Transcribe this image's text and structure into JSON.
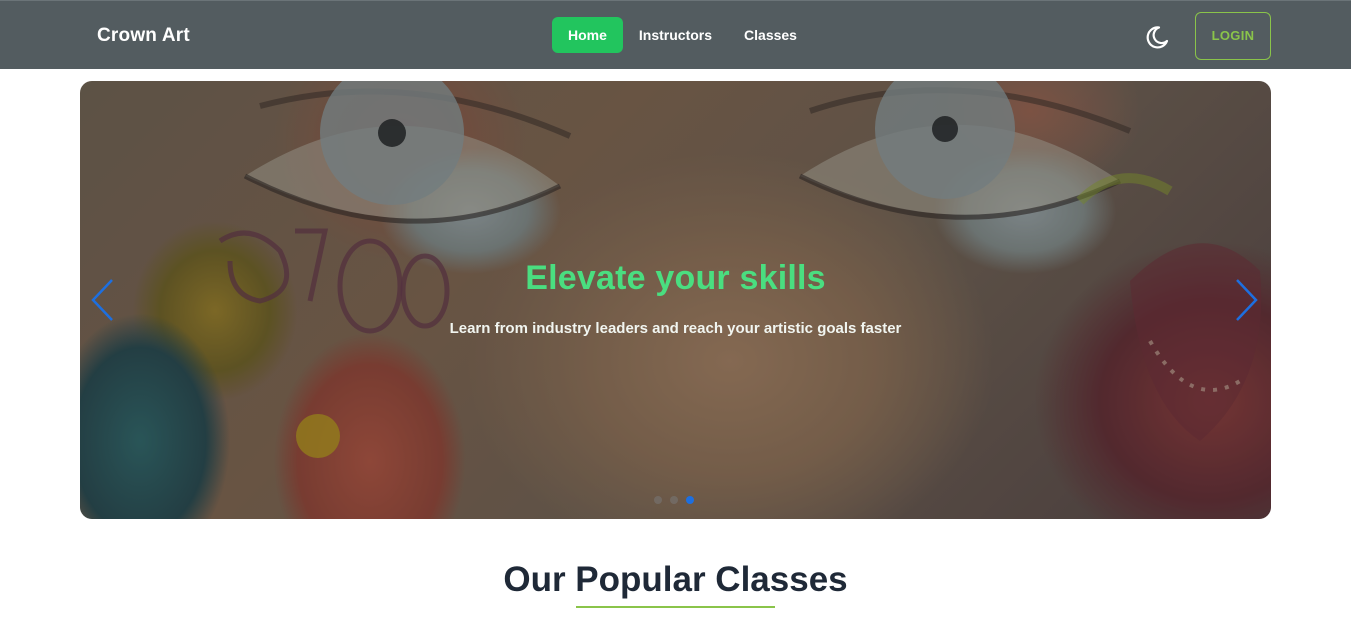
{
  "navbar": {
    "brand": "Crown Art",
    "links": [
      {
        "label": "Home",
        "active": true
      },
      {
        "label": "Instructors",
        "active": false
      },
      {
        "label": "Classes",
        "active": false
      }
    ],
    "theme_icon": "moon-icon",
    "login_label": "LOGIN"
  },
  "hero": {
    "title": "Elevate your skills",
    "subtitle": "Learn from industry leaders and reach your artistic goals faster",
    "prev_icon": "chevron-left-icon",
    "next_icon": "chevron-right-icon",
    "slide_count": 3,
    "active_slide": 3
  },
  "section": {
    "title": "Our Popular Classes"
  },
  "colors": {
    "navbar_bg": "#535c60",
    "accent_green": "#22c55e",
    "hero_title": "#4ade80",
    "login_border": "#8ac44a",
    "arrow_blue": "#1d6fe0"
  }
}
